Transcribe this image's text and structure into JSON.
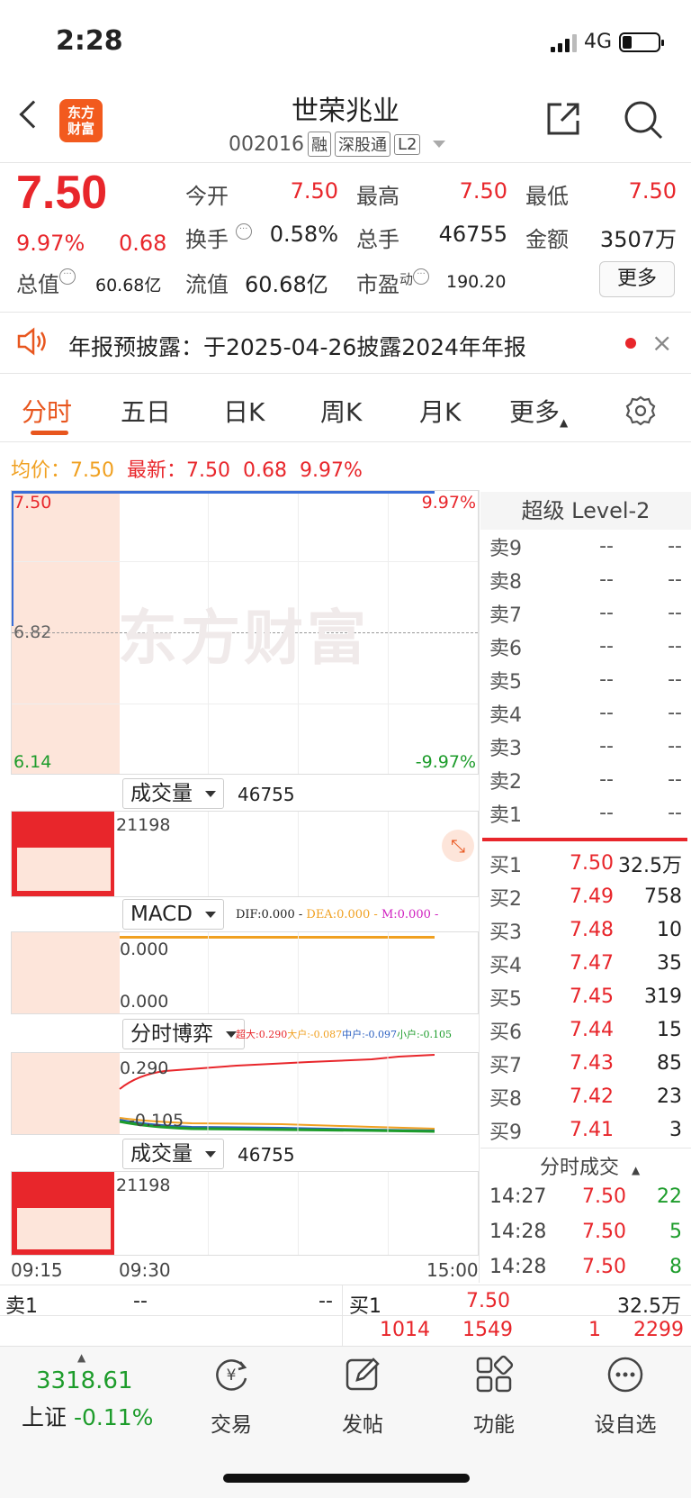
{
  "status": {
    "time": "2:28",
    "network": "4G"
  },
  "header": {
    "logo_line1": "东方",
    "logo_line2": "财富",
    "name": "世荣兆业",
    "code": "002016",
    "tags": [
      "融",
      "深股通",
      "L2"
    ]
  },
  "quote": {
    "price": "7.50",
    "chg_pct": "9.97%",
    "chg_val": "0.68",
    "open_label": "今开",
    "open": "7.50",
    "high_label": "最高",
    "high": "7.50",
    "low_label": "最低",
    "low": "7.50",
    "turnover_label": "换手",
    "turnover": "0.58%",
    "volume_label": "总手",
    "volume": "46755",
    "amount_label": "金额",
    "amount": "3507万",
    "mktcap_label": "总值",
    "mktcap": "60.68亿",
    "float_label": "流值",
    "float": "60.68亿",
    "pe_label": "市盈",
    "pe_sup": "动",
    "pe": "190.20",
    "more": "更多"
  },
  "notice": {
    "text": "年报预披露：于2025-04-26披露2024年年报",
    "close": "×"
  },
  "tabs": [
    "分时",
    "五日",
    "日K",
    "周K",
    "月K",
    "更多"
  ],
  "chart_info": {
    "avg_label": "均价：",
    "avg": "7.50",
    "last_label": "最新：",
    "last": "7.50",
    "chg": "0.68",
    "pct": "9.97%"
  },
  "chart": {
    "y_top": "7.50",
    "y_mid": "6.82",
    "y_bot": "6.14",
    "pct_top": "9.97%",
    "pct_bot": "-9.97%",
    "watermark": "东方财富",
    "vol_label": "成交量",
    "vol_value": "46755",
    "vol_max": "21198",
    "macd_label": "MACD",
    "dif": "DIF:0.000 -",
    "dea": "DEA:0.000 -",
    "m": "M:0.000 -",
    "macd_top": "0.000",
    "macd_bot": "0.000",
    "game_label": "分时博弈",
    "super": "超大:0.290",
    "big": "大户:-0.087",
    "mid": "中户:-0.097",
    "small": "小户:-0.105",
    "game_top": "0.290",
    "game_bot": "-0.105",
    "vol2_label": "成交量",
    "vol2_value": "46755",
    "vol2_max": "21198",
    "t_start": "09:15",
    "t_mid": "09:30",
    "t_end": "15:00"
  },
  "level2": {
    "title": "超级 Level-2",
    "asks": [
      {
        "label": "卖9",
        "price": "--",
        "vol": "--"
      },
      {
        "label": "卖8",
        "price": "--",
        "vol": "--"
      },
      {
        "label": "卖7",
        "price": "--",
        "vol": "--"
      },
      {
        "label": "卖6",
        "price": "--",
        "vol": "--"
      },
      {
        "label": "卖5",
        "price": "--",
        "vol": "--"
      },
      {
        "label": "卖4",
        "price": "--",
        "vol": "--"
      },
      {
        "label": "卖3",
        "price": "--",
        "vol": "--"
      },
      {
        "label": "卖2",
        "price": "--",
        "vol": "--"
      },
      {
        "label": "卖1",
        "price": "--",
        "vol": "--"
      }
    ],
    "bids": [
      {
        "label": "买1",
        "price": "7.50",
        "vol": "32.5万"
      },
      {
        "label": "买2",
        "price": "7.49",
        "vol": "758"
      },
      {
        "label": "买3",
        "price": "7.48",
        "vol": "10"
      },
      {
        "label": "买4",
        "price": "7.47",
        "vol": "35"
      },
      {
        "label": "买5",
        "price": "7.45",
        "vol": "319"
      },
      {
        "label": "买6",
        "price": "7.44",
        "vol": "15"
      },
      {
        "label": "买7",
        "price": "7.43",
        "vol": "85"
      },
      {
        "label": "买8",
        "price": "7.42",
        "vol": "23"
      },
      {
        "label": "买9",
        "price": "7.41",
        "vol": "3"
      }
    ],
    "trades_title": "分时成交",
    "trades": [
      {
        "time": "14:27",
        "price": "7.50",
        "vol": "22"
      },
      {
        "time": "14:28",
        "price": "7.50",
        "vol": "5"
      },
      {
        "time": "14:28",
        "price": "7.50",
        "vol": "8"
      }
    ]
  },
  "bottom_quote": {
    "ask_label": "卖1",
    "ask_price": "--",
    "ask_vol": "--",
    "bid_label": "买1",
    "bid_price": "7.50",
    "bid_vol": "32.5万",
    "n1": "1014",
    "n2": "1549",
    "n3": "1",
    "n4": "2299"
  },
  "nav": {
    "index_value": "3318.61",
    "index_name": "上证",
    "index_chg": "-0.11%",
    "items": [
      "交易",
      "发帖",
      "功能",
      "设自选"
    ]
  },
  "colors": {
    "up": "#e8262b",
    "down": "#1d9c2b",
    "accent": "#e8561e",
    "avg_line": "#f0a020"
  }
}
